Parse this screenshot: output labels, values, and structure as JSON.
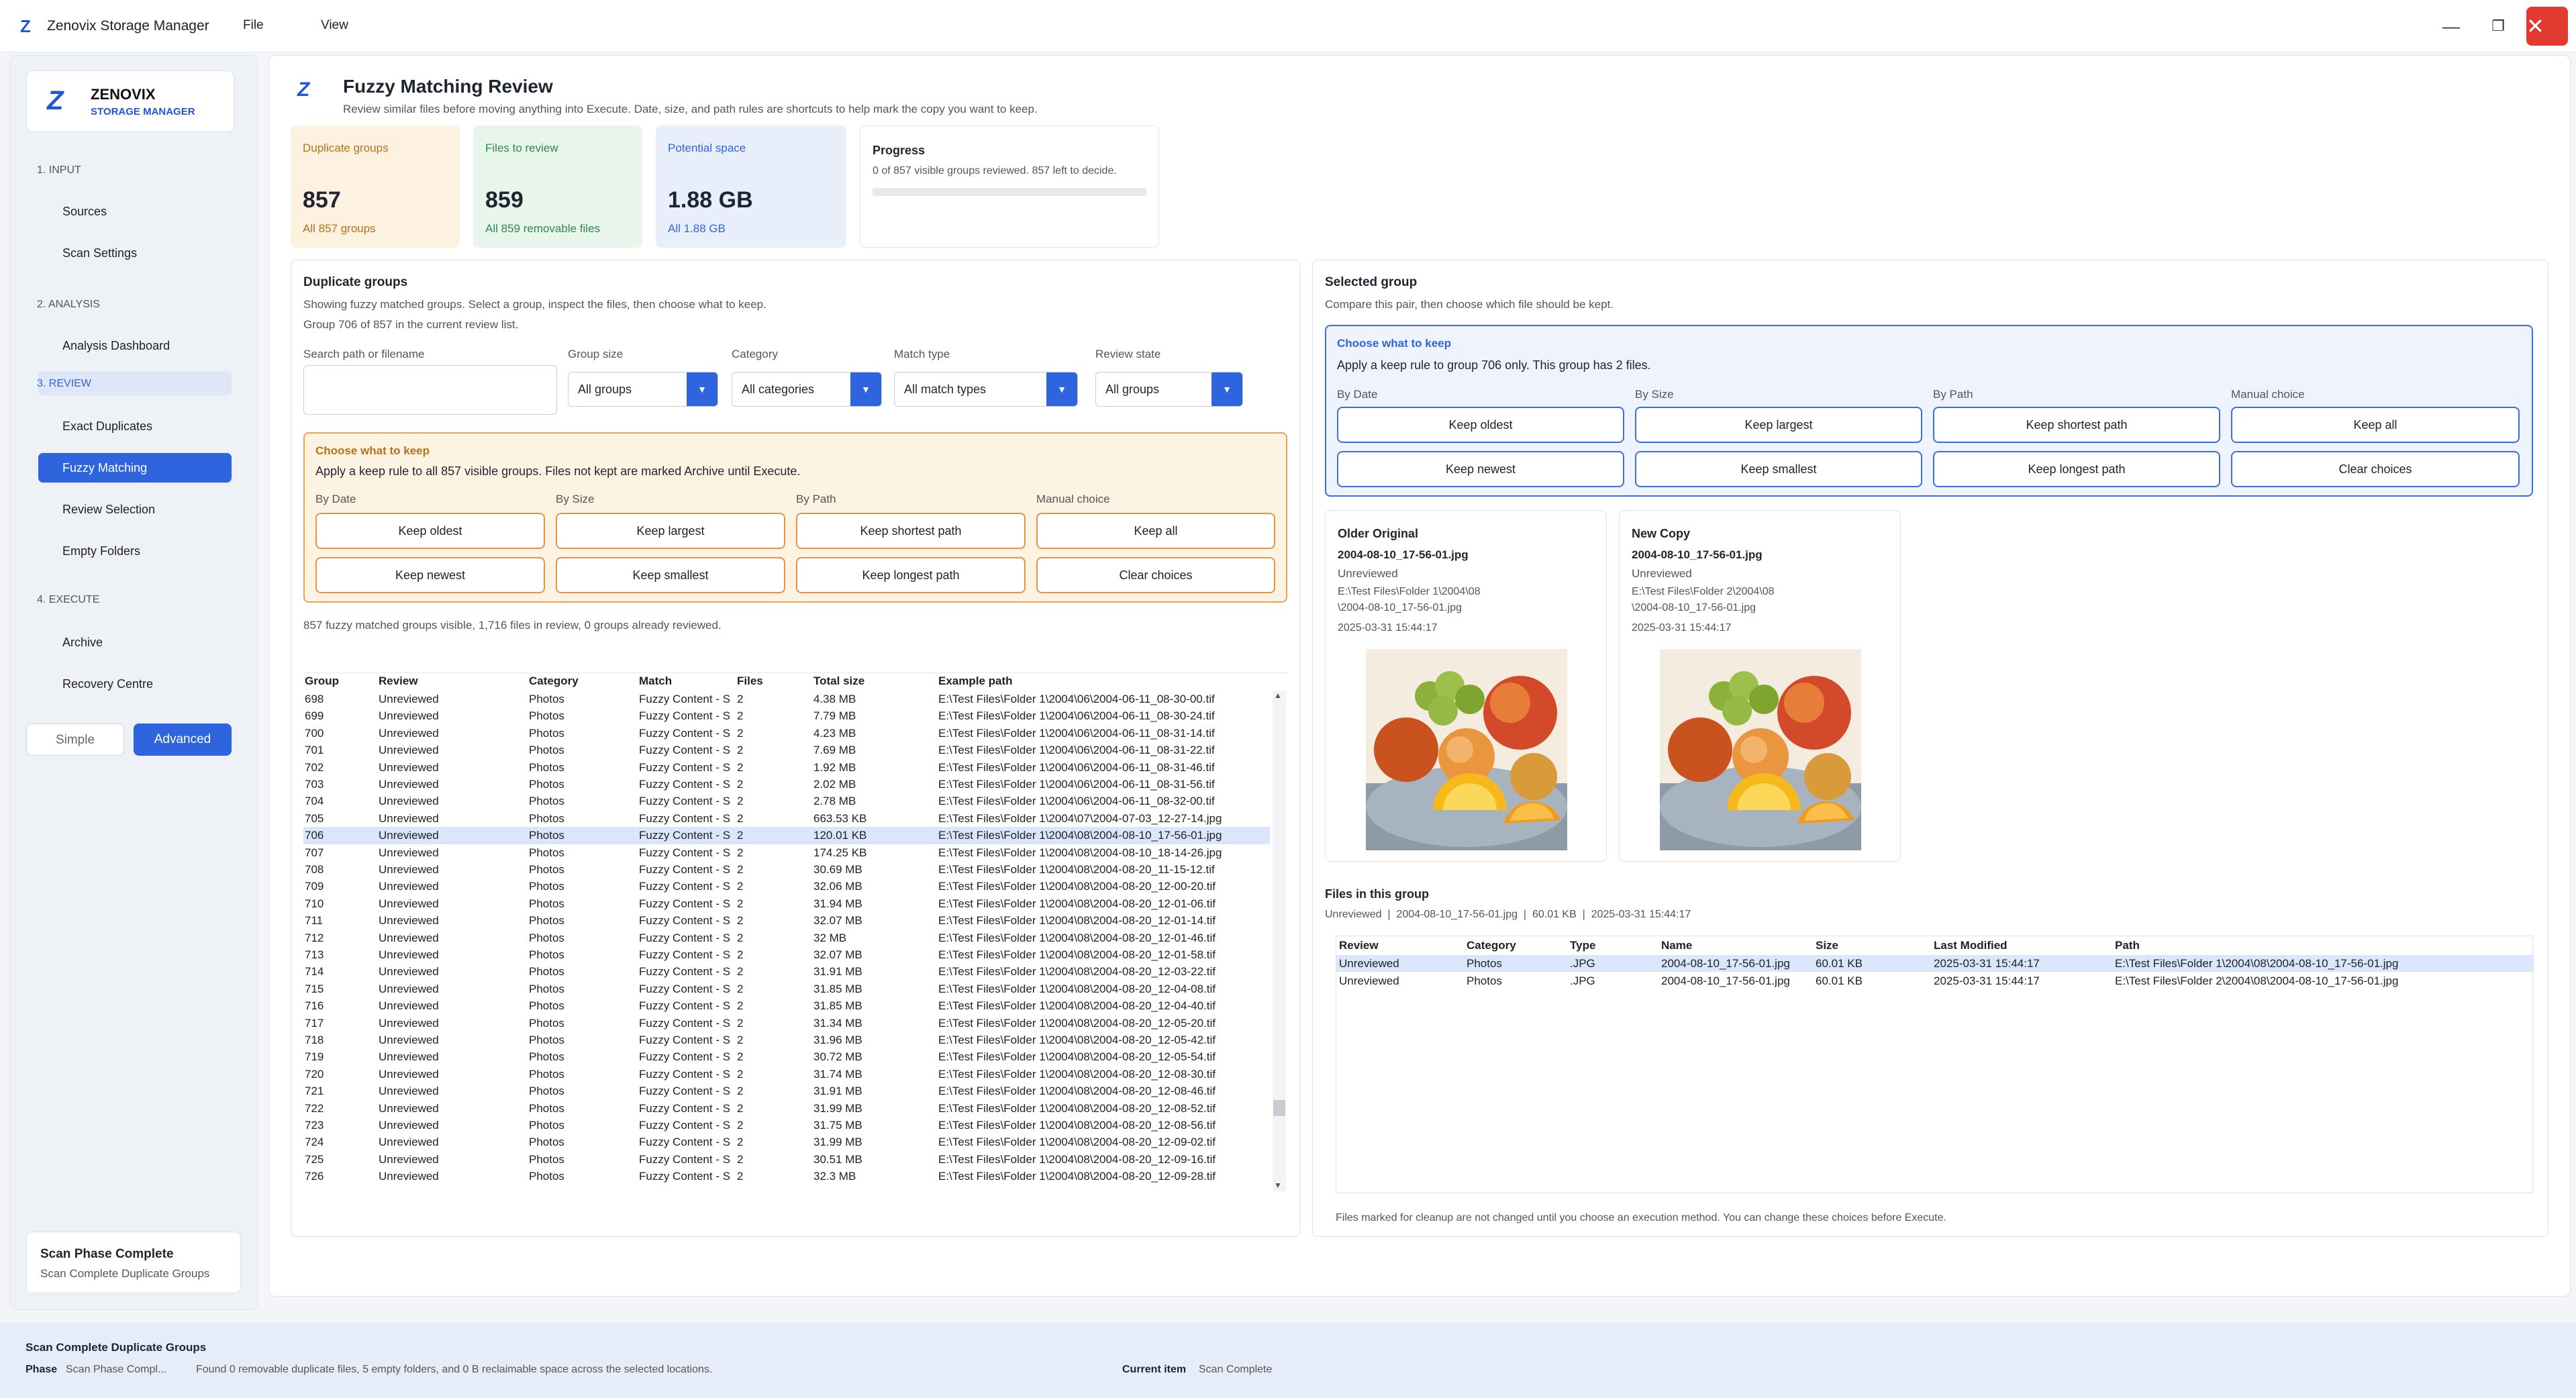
{
  "app": {
    "logo": "Z",
    "title": "Zenovix Storage Manager",
    "menu": [
      "File",
      "View"
    ],
    "controls": {
      "minimize": "—",
      "restore": "❐",
      "close": "✕"
    }
  },
  "sidebar": {
    "brand": {
      "name": "ZENOVIX",
      "sub": "STORAGE MANAGER"
    },
    "sections": [
      {
        "title": "1. INPUT",
        "items": [
          "Sources",
          "Scan Settings"
        ]
      },
      {
        "title": "2. ANALYSIS",
        "items": [
          "Analysis Dashboard"
        ]
      },
      {
        "title": "3. REVIEW",
        "items": [
          "Exact Duplicates",
          "Fuzzy Matching",
          "Review Selection",
          "Empty Folders"
        ]
      },
      {
        "title": "4. EXECUTE",
        "items": [
          "Archive",
          "Recovery Centre"
        ]
      }
    ],
    "active_item": "Fuzzy Matching",
    "mode": {
      "simple": "Simple",
      "advanced": "Advanced"
    },
    "status": {
      "title": "Scan Phase Complete",
      "subtitle": "Scan Complete Duplicate Groups"
    }
  },
  "header": {
    "title": "Fuzzy Matching Review",
    "subtitle": "Review similar files before moving anything into Execute. Date, size, and path rules are shortcuts to help mark the copy you want to keep."
  },
  "stats": [
    {
      "label": "Duplicate groups",
      "value": "857",
      "note": "All 857 groups",
      "color": "#b8711d",
      "bg": "#fdf1df"
    },
    {
      "label": "Files to review",
      "value": "859",
      "note": "All 859 removable files",
      "color": "#2f8a4d",
      "bg": "#e7f5ea"
    },
    {
      "label": "Potential space",
      "value": "1.88 GB",
      "note": "All 1.88 GB",
      "color": "#2f64df",
      "bg": "#e8effb"
    }
  ],
  "progress": {
    "label": "Progress",
    "text": "0 of 857 visible groups reviewed. 857 left to decide.",
    "value": 0
  },
  "groups": {
    "title": "Duplicate groups",
    "desc1": "Showing fuzzy matched groups. Select a group, inspect the files, then choose what to keep.",
    "desc2": "Group 706 of 857 in the current review list.",
    "filters": {
      "search_label": "Search path or filename",
      "search_value": "",
      "size_label": "Group size",
      "size": "All groups",
      "category_label": "Category",
      "category": "All categories",
      "match_label": "Match type",
      "match": "All match types",
      "state_label": "Review state",
      "state": "All groups",
      "arrow": "▼"
    },
    "keep": {
      "title": "Choose what to keep",
      "desc": "Apply a keep rule to all 857 visible groups. Files not kept are marked Archive until Execute.",
      "cols": [
        "By Date",
        "By Size",
        "By Path",
        "Manual choice"
      ],
      "row1": [
        "Keep oldest",
        "Keep largest",
        "Keep shortest path",
        "Keep all"
      ],
      "row2": [
        "Keep newest",
        "Keep smallest",
        "Keep longest path",
        "Clear choices"
      ]
    },
    "summary": "857 fuzzy matched groups visible, 1,716 files in review, 0 groups already reviewed.",
    "columns": [
      "Group",
      "Review",
      "Category",
      "Match",
      "Files",
      "Total size",
      "Example path"
    ],
    "selected": "706",
    "rows": [
      [
        "698",
        "Unreviewed",
        "Photos",
        "Fuzzy Content - S",
        "2",
        "4.38 MB",
        "E:\\Test Files\\Folder 1\\2004\\06\\2004-06-11_08-30-00.tif"
      ],
      [
        "699",
        "Unreviewed",
        "Photos",
        "Fuzzy Content - S",
        "2",
        "7.79 MB",
        "E:\\Test Files\\Folder 1\\2004\\06\\2004-06-11_08-30-24.tif"
      ],
      [
        "700",
        "Unreviewed",
        "Photos",
        "Fuzzy Content - S",
        "2",
        "4.23 MB",
        "E:\\Test Files\\Folder 1\\2004\\06\\2004-06-11_08-31-14.tif"
      ],
      [
        "701",
        "Unreviewed",
        "Photos",
        "Fuzzy Content - S",
        "2",
        "7.69 MB",
        "E:\\Test Files\\Folder 1\\2004\\06\\2004-06-11_08-31-22.tif"
      ],
      [
        "702",
        "Unreviewed",
        "Photos",
        "Fuzzy Content - S",
        "2",
        "1.92 MB",
        "E:\\Test Files\\Folder 1\\2004\\06\\2004-06-11_08-31-46.tif"
      ],
      [
        "703",
        "Unreviewed",
        "Photos",
        "Fuzzy Content - S",
        "2",
        "2.02 MB",
        "E:\\Test Files\\Folder 1\\2004\\06\\2004-06-11_08-31-56.tif"
      ],
      [
        "704",
        "Unreviewed",
        "Photos",
        "Fuzzy Content - S",
        "2",
        "2.78 MB",
        "E:\\Test Files\\Folder 1\\2004\\06\\2004-06-11_08-32-00.tif"
      ],
      [
        "705",
        "Unreviewed",
        "Photos",
        "Fuzzy Content - S",
        "2",
        "663.53 KB",
        "E:\\Test Files\\Folder 1\\2004\\07\\2004-07-03_12-27-14.jpg"
      ],
      [
        "706",
        "Unreviewed",
        "Photos",
        "Fuzzy Content - S",
        "2",
        "120.01 KB",
        "E:\\Test Files\\Folder 1\\2004\\08\\2004-08-10_17-56-01.jpg"
      ],
      [
        "707",
        "Unreviewed",
        "Photos",
        "Fuzzy Content - S",
        "2",
        "174.25 KB",
        "E:\\Test Files\\Folder 1\\2004\\08\\2004-08-10_18-14-26.jpg"
      ],
      [
        "708",
        "Unreviewed",
        "Photos",
        "Fuzzy Content - S",
        "2",
        "30.69 MB",
        "E:\\Test Files\\Folder 1\\2004\\08\\2004-08-20_11-15-12.tif"
      ],
      [
        "709",
        "Unreviewed",
        "Photos",
        "Fuzzy Content - S",
        "2",
        "32.06 MB",
        "E:\\Test Files\\Folder 1\\2004\\08\\2004-08-20_12-00-20.tif"
      ],
      [
        "710",
        "Unreviewed",
        "Photos",
        "Fuzzy Content - S",
        "2",
        "31.94 MB",
        "E:\\Test Files\\Folder 1\\2004\\08\\2004-08-20_12-01-06.tif"
      ],
      [
        "711",
        "Unreviewed",
        "Photos",
        "Fuzzy Content - S",
        "2",
        "32.07 MB",
        "E:\\Test Files\\Folder 1\\2004\\08\\2004-08-20_12-01-14.tif"
      ],
      [
        "712",
        "Unreviewed",
        "Photos",
        "Fuzzy Content - S",
        "2",
        "32 MB",
        "E:\\Test Files\\Folder 1\\2004\\08\\2004-08-20_12-01-46.tif"
      ],
      [
        "713",
        "Unreviewed",
        "Photos",
        "Fuzzy Content - S",
        "2",
        "32.07 MB",
        "E:\\Test Files\\Folder 1\\2004\\08\\2004-08-20_12-01-58.tif"
      ],
      [
        "714",
        "Unreviewed",
        "Photos",
        "Fuzzy Content - S",
        "2",
        "31.91 MB",
        "E:\\Test Files\\Folder 1\\2004\\08\\2004-08-20_12-03-22.tif"
      ],
      [
        "715",
        "Unreviewed",
        "Photos",
        "Fuzzy Content - S",
        "2",
        "31.85 MB",
        "E:\\Test Files\\Folder 1\\2004\\08\\2004-08-20_12-04-08.tif"
      ],
      [
        "716",
        "Unreviewed",
        "Photos",
        "Fuzzy Content - S",
        "2",
        "31.85 MB",
        "E:\\Test Files\\Folder 1\\2004\\08\\2004-08-20_12-04-40.tif"
      ],
      [
        "717",
        "Unreviewed",
        "Photos",
        "Fuzzy Content - S",
        "2",
        "31.34 MB",
        "E:\\Test Files\\Folder 1\\2004\\08\\2004-08-20_12-05-20.tif"
      ],
      [
        "718",
        "Unreviewed",
        "Photos",
        "Fuzzy Content - S",
        "2",
        "31.96 MB",
        "E:\\Test Files\\Folder 1\\2004\\08\\2004-08-20_12-05-42.tif"
      ],
      [
        "719",
        "Unreviewed",
        "Photos",
        "Fuzzy Content - S",
        "2",
        "30.72 MB",
        "E:\\Test Files\\Folder 1\\2004\\08\\2004-08-20_12-05-54.tif"
      ],
      [
        "720",
        "Unreviewed",
        "Photos",
        "Fuzzy Content - S",
        "2",
        "31.74 MB",
        "E:\\Test Files\\Folder 1\\2004\\08\\2004-08-20_12-08-30.tif"
      ],
      [
        "721",
        "Unreviewed",
        "Photos",
        "Fuzzy Content - S",
        "2",
        "31.91 MB",
        "E:\\Test Files\\Folder 1\\2004\\08\\2004-08-20_12-08-46.tif"
      ],
      [
        "722",
        "Unreviewed",
        "Photos",
        "Fuzzy Content - S",
        "2",
        "31.99 MB",
        "E:\\Test Files\\Folder 1\\2004\\08\\2004-08-20_12-08-52.tif"
      ],
      [
        "723",
        "Unreviewed",
        "Photos",
        "Fuzzy Content - S",
        "2",
        "31.75 MB",
        "E:\\Test Files\\Folder 1\\2004\\08\\2004-08-20_12-08-56.tif"
      ],
      [
        "724",
        "Unreviewed",
        "Photos",
        "Fuzzy Content - S",
        "2",
        "31.99 MB",
        "E:\\Test Files\\Folder 1\\2004\\08\\2004-08-20_12-09-02.tif"
      ],
      [
        "725",
        "Unreviewed",
        "Photos",
        "Fuzzy Content - S",
        "2",
        "30.51 MB",
        "E:\\Test Files\\Folder 1\\2004\\08\\2004-08-20_12-09-16.tif"
      ],
      [
        "726",
        "Unreviewed",
        "Photos",
        "Fuzzy Content - S",
        "2",
        "32.3 MB",
        "E:\\Test Files\\Folder 1\\2004\\08\\2004-08-20_12-09-28.tif"
      ]
    ],
    "scroll": {
      "up": "▲",
      "down": "▼"
    }
  },
  "selected_group": {
    "title": "Selected group",
    "desc": "Compare this pair, then choose which file should be kept.",
    "keep": {
      "title": "Choose what to keep",
      "desc": "Apply a keep rule to group 706 only. This group has 2 files.",
      "cols": [
        "By Date",
        "By Size",
        "By Path",
        "Manual choice"
      ],
      "row1": [
        "Keep oldest",
        "Keep largest",
        "Keep shortest path",
        "Keep all"
      ],
      "row2": [
        "Keep newest",
        "Keep smallest",
        "Keep longest path",
        "Clear choices"
      ]
    },
    "compare": [
      {
        "label": "Older Original",
        "file": "2004-08-10_17-56-01.jpg",
        "state": "Unreviewed",
        "path1": "E:\\Test Files\\Folder 1\\2004\\08",
        "path2": "\\2004-08-10_17-56-01.jpg",
        "date": "2025-03-31 15:44:17"
      },
      {
        "label": "New Copy",
        "file": "2004-08-10_17-56-01.jpg",
        "state": "Unreviewed",
        "path1": "E:\\Test Files\\Folder 2\\2004\\08",
        "path2": "\\2004-08-10_17-56-01.jpg",
        "date": "2025-03-31 15:44:17"
      }
    ],
    "files_title": "Files in this group",
    "files_meta": "Unreviewed  |  2004-08-10_17-56-01.jpg  |  60.01 KB  |  2025-03-31 15:44:17",
    "file_columns": [
      "Review",
      "Category",
      "Type",
      "Name",
      "Size",
      "Last Modified",
      "Path"
    ],
    "files": [
      [
        "Unreviewed",
        "Photos",
        ".JPG",
        "2004-08-10_17-56-01.jpg",
        "60.01 KB",
        "2025-03-31 15:44:17",
        "E:\\Test Files\\Folder 1\\2004\\08\\2004-08-10_17-56-01.jpg"
      ],
      [
        "Unreviewed",
        "Photos",
        ".JPG",
        "2004-08-10_17-56-01.jpg",
        "60.01 KB",
        "2025-03-31 15:44:17",
        "E:\\Test Files\\Folder 2\\2004\\08\\2004-08-10_17-56-01.jpg"
      ]
    ],
    "footnote": "Files marked for cleanup are not changed until you choose an execution method. You can change these choices before Execute."
  },
  "statusbar": {
    "title": "Scan Complete Duplicate Groups",
    "phase_label": "Phase",
    "phase": "Scan Phase Compl...",
    "message": "Found 0 removable duplicate files, 5 empty folders, and 0 B reclaimable space across the selected locations.",
    "current_label": "Current item",
    "current": "Scan Complete"
  }
}
